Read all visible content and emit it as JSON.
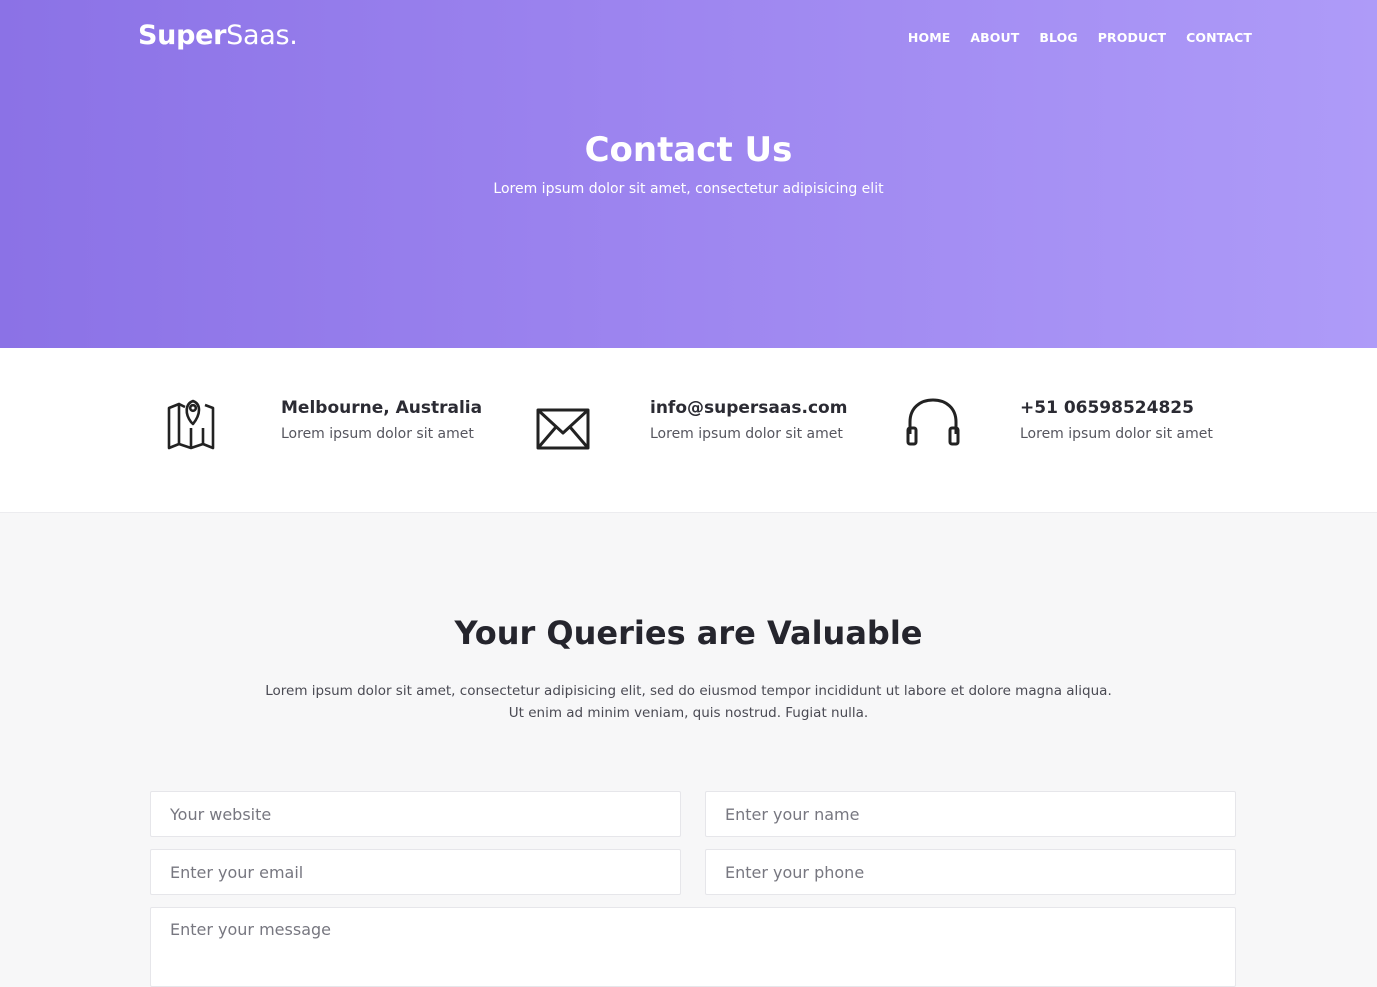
{
  "header": {
    "brand_bold": "Super",
    "brand_light": "Saas.",
    "nav": [
      "HOME",
      "ABOUT",
      "BLOG",
      "PRODUCT",
      "CONTACT"
    ]
  },
  "hero": {
    "title": "Contact Us",
    "subtitle": "Lorem ipsum dolor sit amet, consectetur adipisicing elit"
  },
  "info": [
    {
      "icon": "map-pin-icon",
      "title": "Melbourne, Australia",
      "desc": "Lorem ipsum dolor sit amet"
    },
    {
      "icon": "envelope-icon",
      "title": "info@supersaas.com",
      "desc": "Lorem ipsum dolor sit amet"
    },
    {
      "icon": "headphones-icon",
      "title": "+51 06598524825",
      "desc": "Lorem ipsum dolor sit amet"
    }
  ],
  "queries": {
    "title": "Your Queries are Valuable",
    "desc_line1": "Lorem ipsum dolor sit amet, consectetur adipisicing elit, sed do eiusmod tempor incididunt ut labore et dolore magna aliqua.",
    "desc_line2": "Ut enim ad minim veniam, quis nostrud. Fugiat nulla."
  },
  "form": {
    "website_placeholder": "Your website",
    "name_placeholder": "Enter your name",
    "email_placeholder": "Enter your email",
    "phone_placeholder": "Enter your phone",
    "message_placeholder": "Enter your message"
  },
  "colors": {
    "hero_start": "#8b72e6",
    "hero_end": "#ae9bf8"
  }
}
